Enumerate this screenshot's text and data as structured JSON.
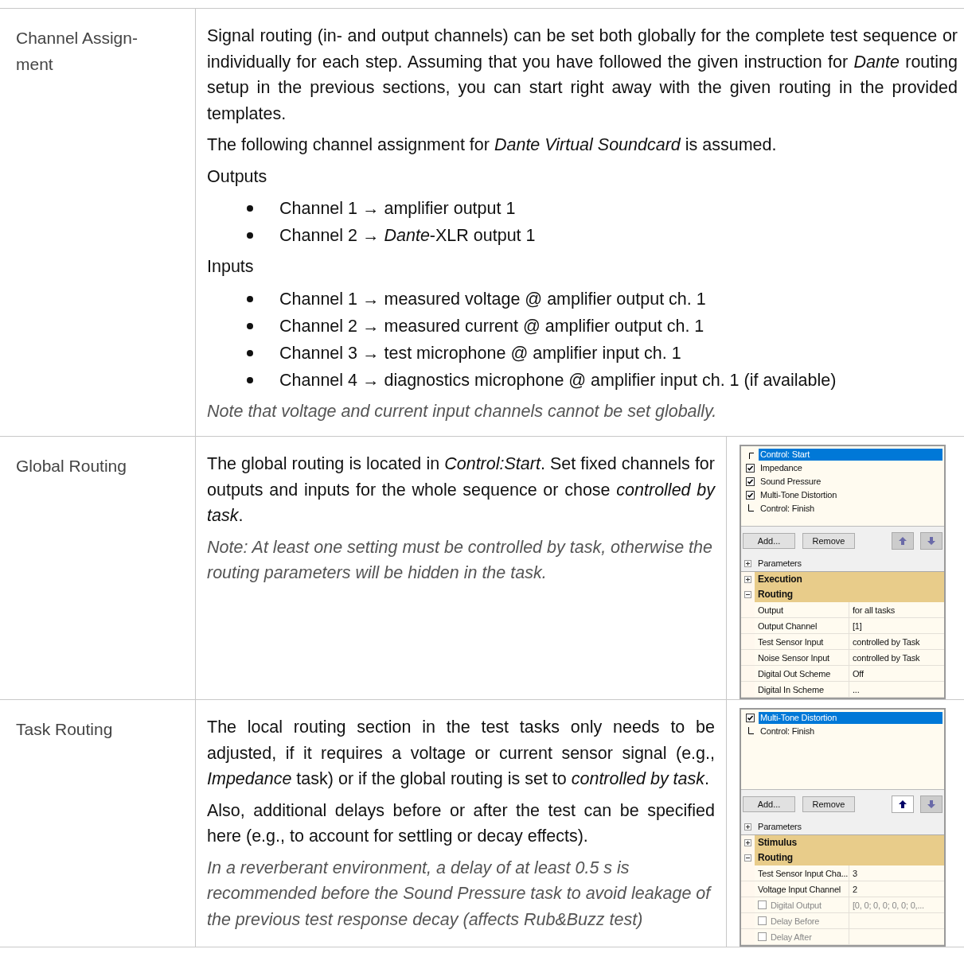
{
  "rows": [
    {
      "label": "Channel Assign-ment",
      "content": [
        {
          "kind": "text",
          "text": "Signal routing (in- and output channels) can be set both globally for the complete test sequence or individually for each step. Assuming that you have followed the given instruction for *Dante* routing setup in the previous sections, you can start right away with the given routing in the provided templates."
        },
        {
          "kind": "text",
          "text": "The following channel assignment for *Dante Virtual Soundcard* is assumed."
        },
        {
          "kind": "heading",
          "text": "Outputs"
        },
        {
          "kind": "bullets",
          "items": [
            "Channel 1 → amplifier output 1",
            "Channel 2 → *Dante*-XLR output 1"
          ]
        },
        {
          "kind": "heading",
          "text": "Inputs"
        },
        {
          "kind": "bullets",
          "items": [
            "Channel 1 → measured voltage @ amplifier output ch. 1",
            "Channel 2 → measured current @ amplifier output ch. 1",
            "Channel 3 → test microphone @ amplifier input ch. 1",
            "Channel 4 → diagnostics microphone @ amplifier input ch. 1 (if available)"
          ]
        },
        {
          "kind": "note",
          "text": "Note that voltage and current input channels cannot be set globally."
        }
      ]
    },
    {
      "label": "Global Routing",
      "content": [
        {
          "kind": "text",
          "text": "The global routing is located in *Control:Start*. Set fixed channels for outputs and inputs for the whole sequence or chose *controlled by task*."
        },
        {
          "kind": "note",
          "text": "Note: At least one setting must be controlled by task, otherwise the routing parameters will be hidden in the task."
        }
      ],
      "screenshot": {
        "tree": [
          {
            "kind": "start",
            "label": "Control: Start",
            "selected": true
          },
          {
            "kind": "check",
            "label": "Impedance",
            "checked": true,
            "selected": false
          },
          {
            "kind": "check",
            "label": "Sound Pressure",
            "checked": true,
            "selected": false
          },
          {
            "kind": "check",
            "label": "Multi-Tone Distortion",
            "checked": true,
            "selected": false
          },
          {
            "kind": "finish",
            "label": "Control: Finish",
            "selected": false
          }
        ],
        "buttons": [
          "Add...",
          "Remove"
        ],
        "arrows": [
          {
            "kind": "up",
            "enabled": false
          },
          {
            "kind": "down",
            "enabled": false
          }
        ],
        "parameters_label": "Parameters",
        "categories": [
          {
            "name": "Execution",
            "expanded": false
          },
          {
            "name": "Routing",
            "expanded": true,
            "rows": [
              {
                "kind": "plain",
                "name": "Output",
                "value": "for all tasks"
              },
              {
                "kind": "plain",
                "name": "Output Channel",
                "value": "[1]"
              },
              {
                "kind": "plain",
                "name": "Test Sensor Input",
                "value": "controlled by Task"
              },
              {
                "kind": "plain",
                "name": "Noise Sensor Input",
                "value": "controlled by Task"
              },
              {
                "kind": "plain",
                "name": "Digital Out Scheme",
                "value": "Off"
              },
              {
                "kind": "plain",
                "name": "Digital In Scheme",
                "value": "..."
              }
            ]
          }
        ]
      }
    },
    {
      "label": "Task Routing",
      "content": [
        {
          "kind": "text",
          "text": "The local routing section in the test tasks only needs to be adjusted, if it requires a voltage or current sensor signal (e.g., *Impedance* task) or if the global routing is set to *controlled by task*."
        },
        {
          "kind": "text",
          "text": "Also, additional delays before or after the test can be specified here (e.g., to account for settling or decay effects)."
        },
        {
          "kind": "note",
          "text": "In a reverberant environment, a delay of at least 0.5 s is recommended before the Sound Pressure task to avoid leakage of the previous test response decay (affects Rub&Buzz test)"
        }
      ],
      "screenshot": {
        "tree": [
          {
            "kind": "check",
            "label": "Multi-Tone Distortion",
            "checked": true,
            "selected": true
          },
          {
            "kind": "finish",
            "label": "Control: Finish",
            "selected": false
          }
        ],
        "buttons": [
          "Add...",
          "Remove"
        ],
        "arrows": [
          {
            "kind": "up",
            "enabled": true
          },
          {
            "kind": "down",
            "enabled": false
          }
        ],
        "parameters_label": "Parameters",
        "categories": [
          {
            "name": "Stimulus",
            "expanded": false
          },
          {
            "name": "Routing",
            "expanded": true,
            "rows": [
              {
                "kind": "plain",
                "name": "Test Sensor Input Cha...",
                "value": "3"
              },
              {
                "kind": "plain",
                "name": "Voltage Input Channel",
                "value": "2"
              },
              {
                "kind": "checkbox",
                "name": "Digital Output",
                "value": "[0, 0; 0, 0; 0, 0; 0,...",
                "checked": false
              },
              {
                "kind": "checkbox",
                "name": "Delay Before",
                "checked": false
              },
              {
                "kind": "checkbox",
                "name": "Delay After",
                "checked": false
              }
            ]
          }
        ]
      }
    }
  ]
}
